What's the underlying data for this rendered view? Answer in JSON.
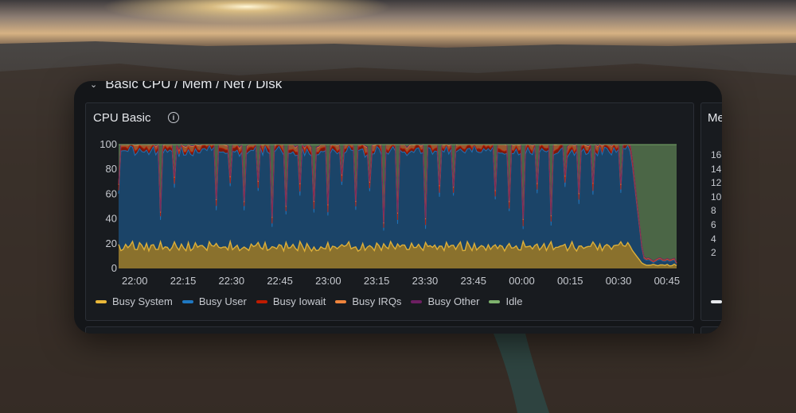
{
  "row": {
    "title": "Basic CPU / Mem / Net / Disk"
  },
  "panel": {
    "title": "CPU Basic",
    "info_icon": "info-icon"
  },
  "panel2": {
    "title": "Me",
    "yticks": [
      "16",
      "14",
      "12",
      "10",
      "8",
      "6",
      "4",
      "2"
    ]
  },
  "colors": {
    "busy_system": "#eab839",
    "busy_user": "#1f78c1",
    "busy_iowait": "#bf1b00",
    "busy_irqs": "#ef843c",
    "busy_other": "#6d1f62",
    "idle": "#7eb26d"
  },
  "chart_data": {
    "type": "area",
    "stacked": true,
    "ylim": [
      0,
      100
    ],
    "yticks": [
      "100",
      "80",
      "60",
      "40",
      "20",
      "0"
    ],
    "xticks": [
      "22:00",
      "22:15",
      "22:30",
      "22:45",
      "23:00",
      "23:15",
      "23:30",
      "23:45",
      "00:00",
      "00:15",
      "00:30",
      "00:45"
    ],
    "x_range": [
      "21:55",
      "00:48"
    ],
    "legend_position": "bottom-left",
    "series": [
      {
        "name": "Busy System",
        "approx_values": "≈15 (range 10–20) until 00:33, then ≈2"
      },
      {
        "name": "Busy User",
        "approx_values": "≈75–82 until 00:33, dips to ≈50–60 periodically, then ≈5"
      },
      {
        "name": "Busy Iowait",
        "approx_values": "≈2"
      },
      {
        "name": "Busy IRQs",
        "approx_values": "≈1–5"
      },
      {
        "name": "Busy Other",
        "approx_values": "≈0.5"
      },
      {
        "name": "Idle",
        "approx_values": "≈0 until 00:33 (spikes at dips), then ≈90"
      }
    ],
    "legend": [
      {
        "label": "Busy System",
        "color": "#eab839"
      },
      {
        "label": "Busy User",
        "color": "#1f78c1"
      },
      {
        "label": "Busy Iowait",
        "color": "#bf1b00"
      },
      {
        "label": "Busy IRQs",
        "color": "#ef843c"
      },
      {
        "label": "Busy Other",
        "color": "#6d1f62"
      },
      {
        "label": "Idle",
        "color": "#7eb26d"
      }
    ]
  }
}
